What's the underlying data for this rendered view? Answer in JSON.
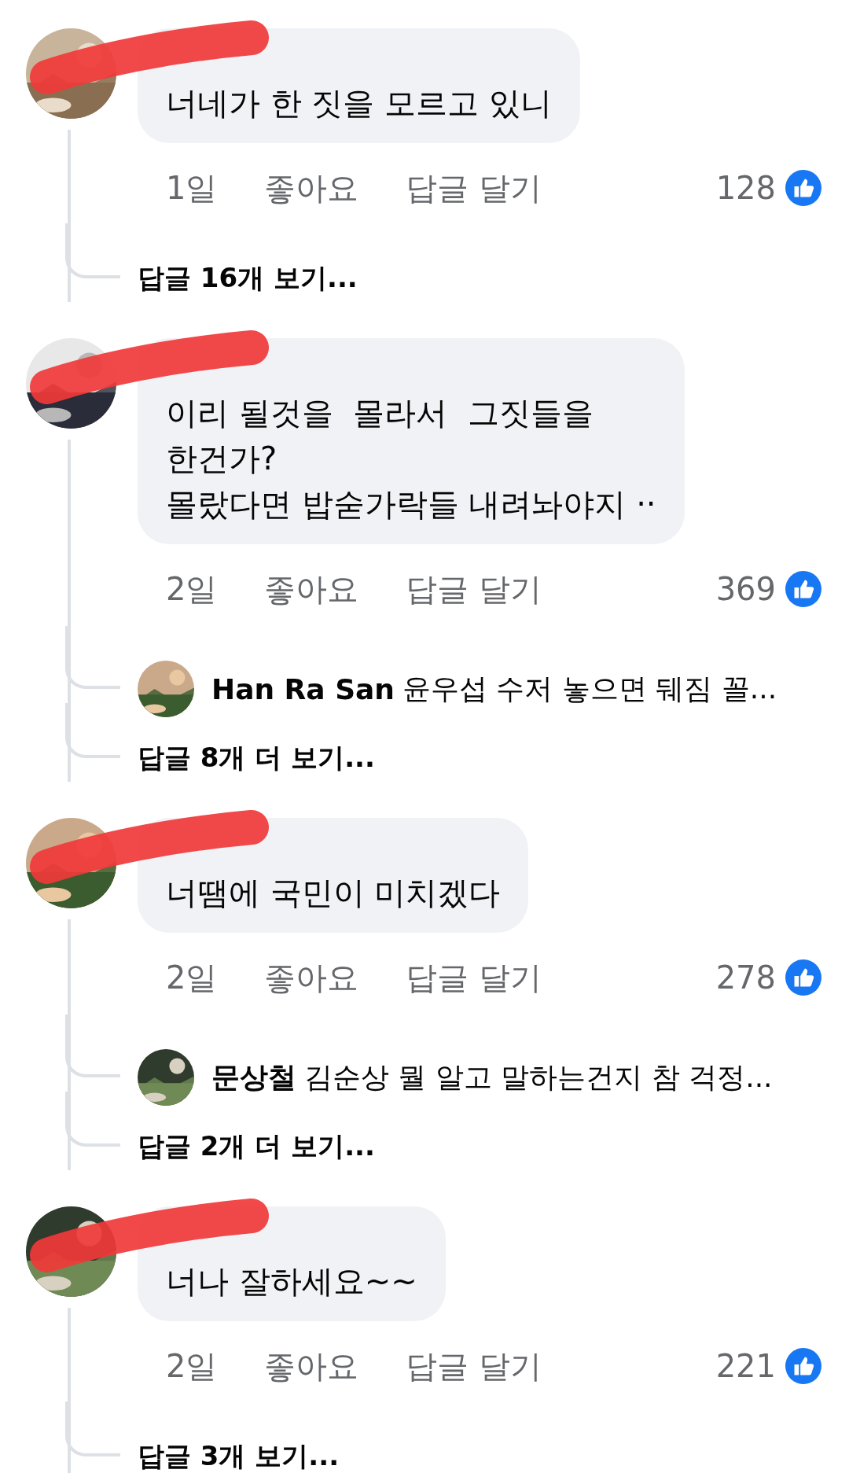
{
  "comments": [
    {
      "redacted": true,
      "text": [
        "너네가 한 짓을 모르고 있니"
      ],
      "time": "1일",
      "like": "좋아요",
      "reply": "답글 달기",
      "count": "128",
      "more": "답글 16개 보기..."
    },
    {
      "redacted": true,
      "text": [
        "이리 될것을  몰라서  그짓들을",
        "한건가?",
        "몰랐다면 밥숟가락들 내려놔야지 ··"
      ],
      "time": "2일",
      "like": "좋아요",
      "reply": "답글 달기",
      "count": "369",
      "preview": {
        "author": "Han Ra San",
        "text": "윤우섭 수저 놓으면 뒈짐 꼴..."
      },
      "more": "답글 8개 더 보기..."
    },
    {
      "redacted": true,
      "text": [
        "너땜에 국민이 미치겠다"
      ],
      "time": "2일",
      "like": "좋아요",
      "reply": "답글 달기",
      "count": "278",
      "preview": {
        "author": "문상철",
        "text": "김순상 뭘 알고 말하는건지 참 걱정..."
      },
      "more": "답글 2개 더 보기..."
    },
    {
      "redacted": true,
      "text": [
        "너나 잘하세요~~"
      ],
      "time": "2일",
      "like": "좋아요",
      "reply": "답글 달기",
      "count": "221",
      "more": "답글 3개 보기..."
    }
  ]
}
